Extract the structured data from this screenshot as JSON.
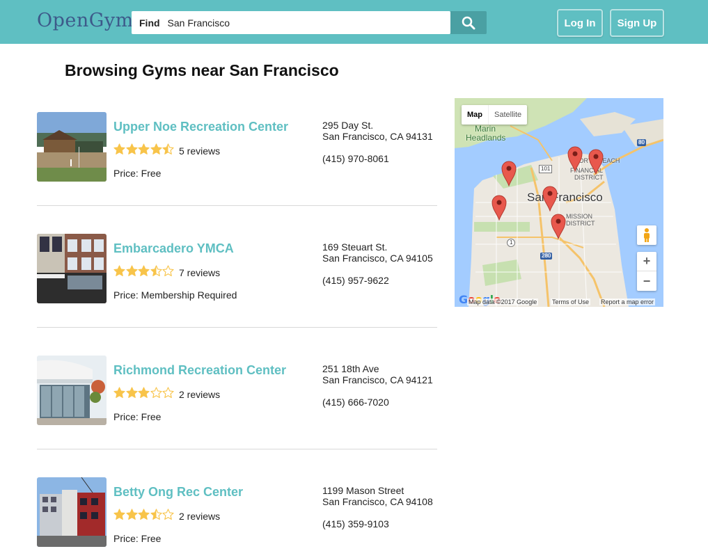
{
  "header": {
    "logo": "OpenGym",
    "find_label": "Find",
    "search_value": "San Francisco",
    "login_label": "Log In",
    "signup_label": "Sign Up",
    "search_icon": "search-icon"
  },
  "page_title": "Browsing Gyms near San Francisco",
  "results": [
    {
      "name": "Upper Noe Recreation Center",
      "rating": 4.5,
      "reviews": "5 reviews",
      "price": "Price: Free",
      "address_line1": "295 Day St.",
      "address_line2": "San Francisco, CA 94131",
      "phone": "(415) 970-8061"
    },
    {
      "name": "Embarcadero YMCA",
      "rating": 3.5,
      "reviews": "7 reviews",
      "price": "Price: Membership Required",
      "address_line1": "169 Steuart St.",
      "address_line2": "San Francisco, CA 94105",
      "phone": "(415) 957-9622"
    },
    {
      "name": "Richmond Recreation Center",
      "rating": 3,
      "reviews": "2 reviews",
      "price": "Price: Free",
      "address_line1": "251 18th Ave",
      "address_line2": "San Francisco, CA 94121",
      "phone": "(415) 666-7020"
    },
    {
      "name": "Betty Ong Rec Center",
      "rating": 3.5,
      "reviews": "2 reviews",
      "price": "Price: Free",
      "address_line1": "1199 Mason Street",
      "address_line2": "San Francisco, CA 94108",
      "phone": "(415) 359-9103"
    }
  ],
  "map": {
    "map_type_map": "Map",
    "map_type_satellite": "Satellite",
    "city_label": "San Francisco",
    "label_marin": "Marin",
    "label_headlands": "Headlands",
    "label_northbeach": "NORTH BEACH",
    "label_financial": "FINANCIAL",
    "label_district": "DISTRICT",
    "label_mission": "MISSION",
    "label_mission_district": "DISTRICT",
    "highway_101": "101",
    "highway_80": "80",
    "highway_1": "1",
    "highway_280": "280",
    "zoom_in": "+",
    "zoom_out": "−",
    "google_logo": "Google",
    "map_data": "Map data ©2017 Google",
    "terms": "Terms of Use",
    "report": "Report a map error"
  },
  "colors": {
    "header_bg": "#5fbfc2",
    "accent": "#5fbfc2",
    "star": "#f8c44a",
    "marker": "#e8584d"
  }
}
